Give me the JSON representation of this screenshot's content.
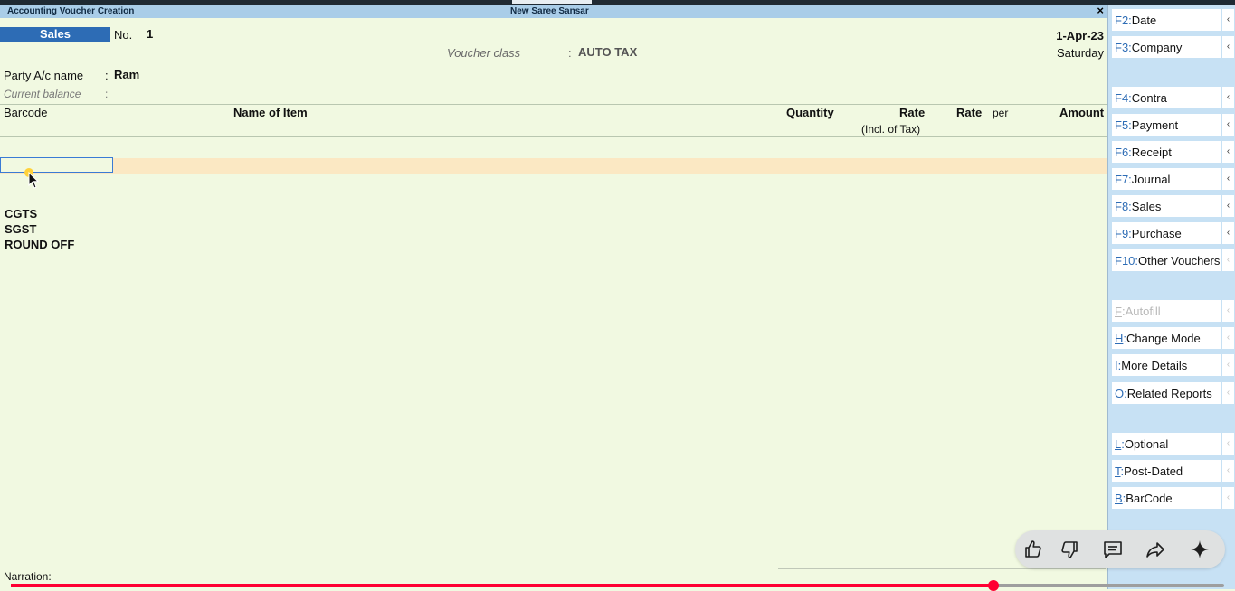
{
  "window": {
    "title": "Accounting Voucher Creation",
    "company": "New Saree Sansar",
    "close": "×"
  },
  "voucher": {
    "type": "Sales",
    "no_label": "No.",
    "no_value": "1",
    "class_label": "Voucher class",
    "class_sep": ":",
    "class_value": "AUTO TAX",
    "date": "1-Apr-23",
    "day": "Saturday",
    "party_label": "Party A/c name",
    "party_sep": ":",
    "party_value": "Ram",
    "balance_label": "Current balance",
    "balance_sep": ":"
  },
  "columns": {
    "barcode": "Barcode",
    "item": "Name of Item",
    "quantity": "Quantity",
    "rate_incl": "Rate",
    "rate_incl_sub": "(Incl. of Tax)",
    "rate": "Rate",
    "per": "per",
    "amount": "Amount"
  },
  "tax_lines": [
    "CGTS",
    "SGST",
    "ROUND OFF"
  ],
  "narration_label": "Narration:",
  "sidebar": {
    "buttons": [
      {
        "key": "F2",
        "label": "Date",
        "disabled": false,
        "arrow": true
      },
      {
        "key": "F3",
        "label": "Company",
        "disabled": false,
        "arrow": true
      },
      {
        "key": "F4",
        "label": "Contra",
        "disabled": false,
        "arrow": true
      },
      {
        "key": "F5",
        "label": "Payment",
        "disabled": false,
        "arrow": true
      },
      {
        "key": "F6",
        "label": "Receipt",
        "disabled": false,
        "arrow": true
      },
      {
        "key": "F7",
        "label": "Journal",
        "disabled": false,
        "arrow": true
      },
      {
        "key": "F8",
        "label": "Sales",
        "disabled": false,
        "arrow": true
      },
      {
        "key": "F9",
        "label": "Purchase",
        "disabled": false,
        "arrow": true
      },
      {
        "key": "F10",
        "label": "Other Vouchers",
        "disabled": false,
        "arrow": false
      },
      {
        "key": "F",
        "label": "Autofill",
        "disabled": true,
        "arrow": false
      },
      {
        "key": "H",
        "label": "Change Mode",
        "disabled": false,
        "arrow": false
      },
      {
        "key": "I",
        "label": "More Details",
        "disabled": false,
        "arrow": false
      },
      {
        "key": "O",
        "label": "Related Reports",
        "disabled": false,
        "arrow": false
      },
      {
        "key": "L",
        "label": "Optional",
        "disabled": false,
        "arrow": false
      },
      {
        "key": "T",
        "label": "Post-Dated",
        "disabled": false,
        "arrow": false
      },
      {
        "key": "B",
        "label": "BarCode",
        "disabled": false,
        "arrow": false
      }
    ]
  },
  "video": {
    "progress": 0.81,
    "icons": [
      "thumbs-up-icon",
      "thumbs-down-icon",
      "comment-icon",
      "share-icon",
      "sparkle-icon"
    ]
  },
  "colors": {
    "background": "#f1f9e1",
    "titlebar": "#a9cde8",
    "voucher_type": "#2d6cb5",
    "row_highlight": "#fbe8c3",
    "sidebar": "#c7e1f4",
    "progress": "#ff0033"
  }
}
